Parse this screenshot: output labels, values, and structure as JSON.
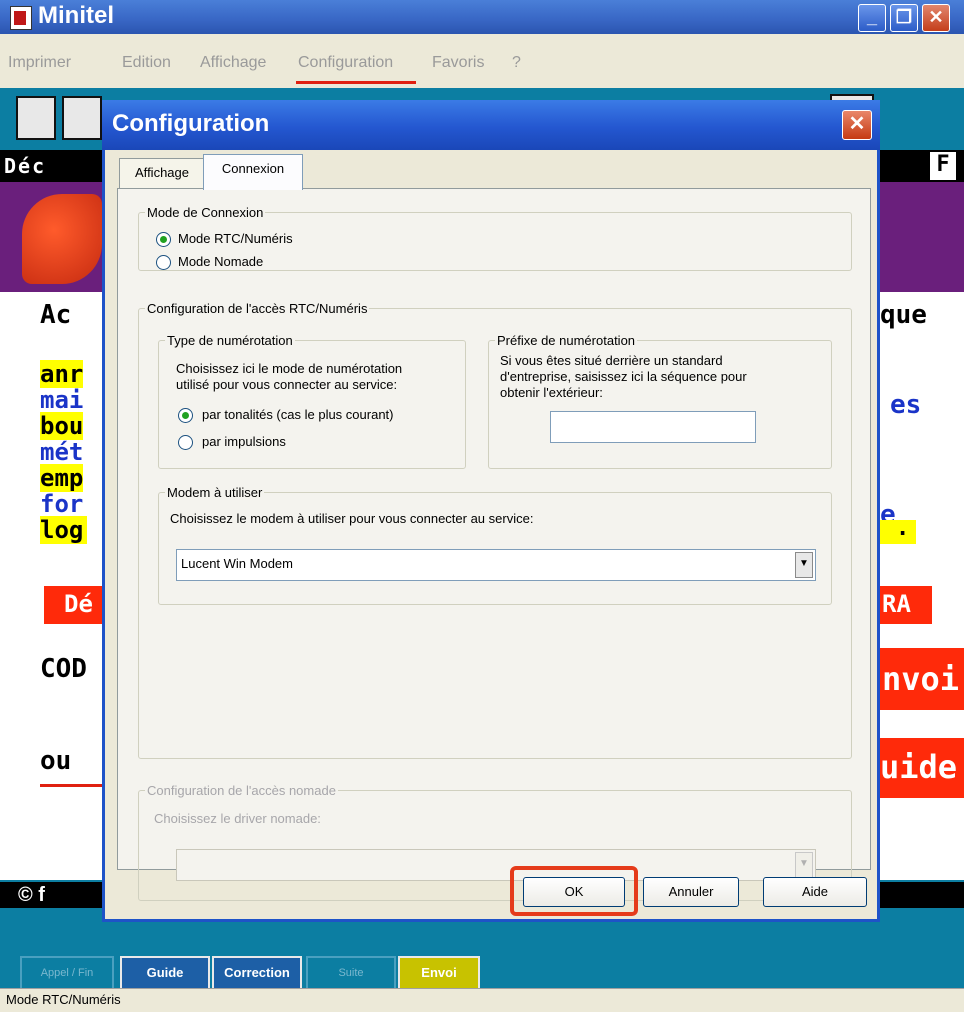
{
  "main_window": {
    "title": "Minitel",
    "menu": [
      "Imprimer",
      "Edition",
      "Affichage",
      "Configuration",
      "Favoris",
      "?"
    ],
    "screen": {
      "header_text": "Déc",
      "header_right": "F",
      "row_labels": [
        "Ac",
        "anr",
        "mai",
        "bou",
        "mét",
        "emp",
        "for",
        "log"
      ],
      "right_words": [
        "que",
        "es",
        "e",
        "."
      ],
      "red_left": "Dé",
      "red_right": "RA",
      "cod_label": "COD",
      "envoi_label": "nvoi",
      "ou_label": "ou",
      "guide_label": "uide",
      "copyright": "© f"
    },
    "footer_buttons": {
      "left_faded": "Appel / Fin",
      "guide": "Guide",
      "correction": "Correction",
      "faded_mid": "Suite",
      "envoi": "Envoi"
    },
    "status_text": "Mode RTC/Numéris"
  },
  "dialog": {
    "title": "Configuration",
    "tabs": [
      "Affichage",
      "Connexion"
    ],
    "mode_group": {
      "legend": "Mode de Connexion",
      "options": [
        "Mode RTC/Numéris",
        "Mode Nomade"
      ],
      "selected": 0
    },
    "rtc_group": {
      "legend": "Configuration de l'accès RTC/Numéris",
      "dialing": {
        "legend": "Type de numérotation",
        "help_line1": "Choisissez ici le mode de numérotation",
        "help_line2": "utilisé pour vous connecter au service:",
        "options": [
          "par tonalités (cas le plus courant)",
          "par impulsions"
        ],
        "selected": 0
      },
      "prefix": {
        "legend": "Préfixe de numérotation",
        "help_line1": "Si vous êtes situé derrière un standard",
        "help_line2": "d'entreprise, saisissez ici la séquence pour",
        "help_line3": "obtenir l'extérieur:",
        "value": ""
      },
      "modem": {
        "legend": "Modem à utiliser",
        "help": "Choisissez le modem à utiliser pour vous connecter au service:",
        "selected": "Lucent Win Modem"
      }
    },
    "nomade_group": {
      "legend": "Configuration de l'accès nomade",
      "help": "Choisissez le driver nomade:",
      "selected": ""
    },
    "buttons": {
      "ok": "OK",
      "cancel": "Annuler",
      "help": "Aide"
    }
  },
  "colors": {
    "highlight_red": "#e53b1a",
    "toolbar_teal": "#0c7ea2",
    "title_blue": "#2457d0"
  }
}
